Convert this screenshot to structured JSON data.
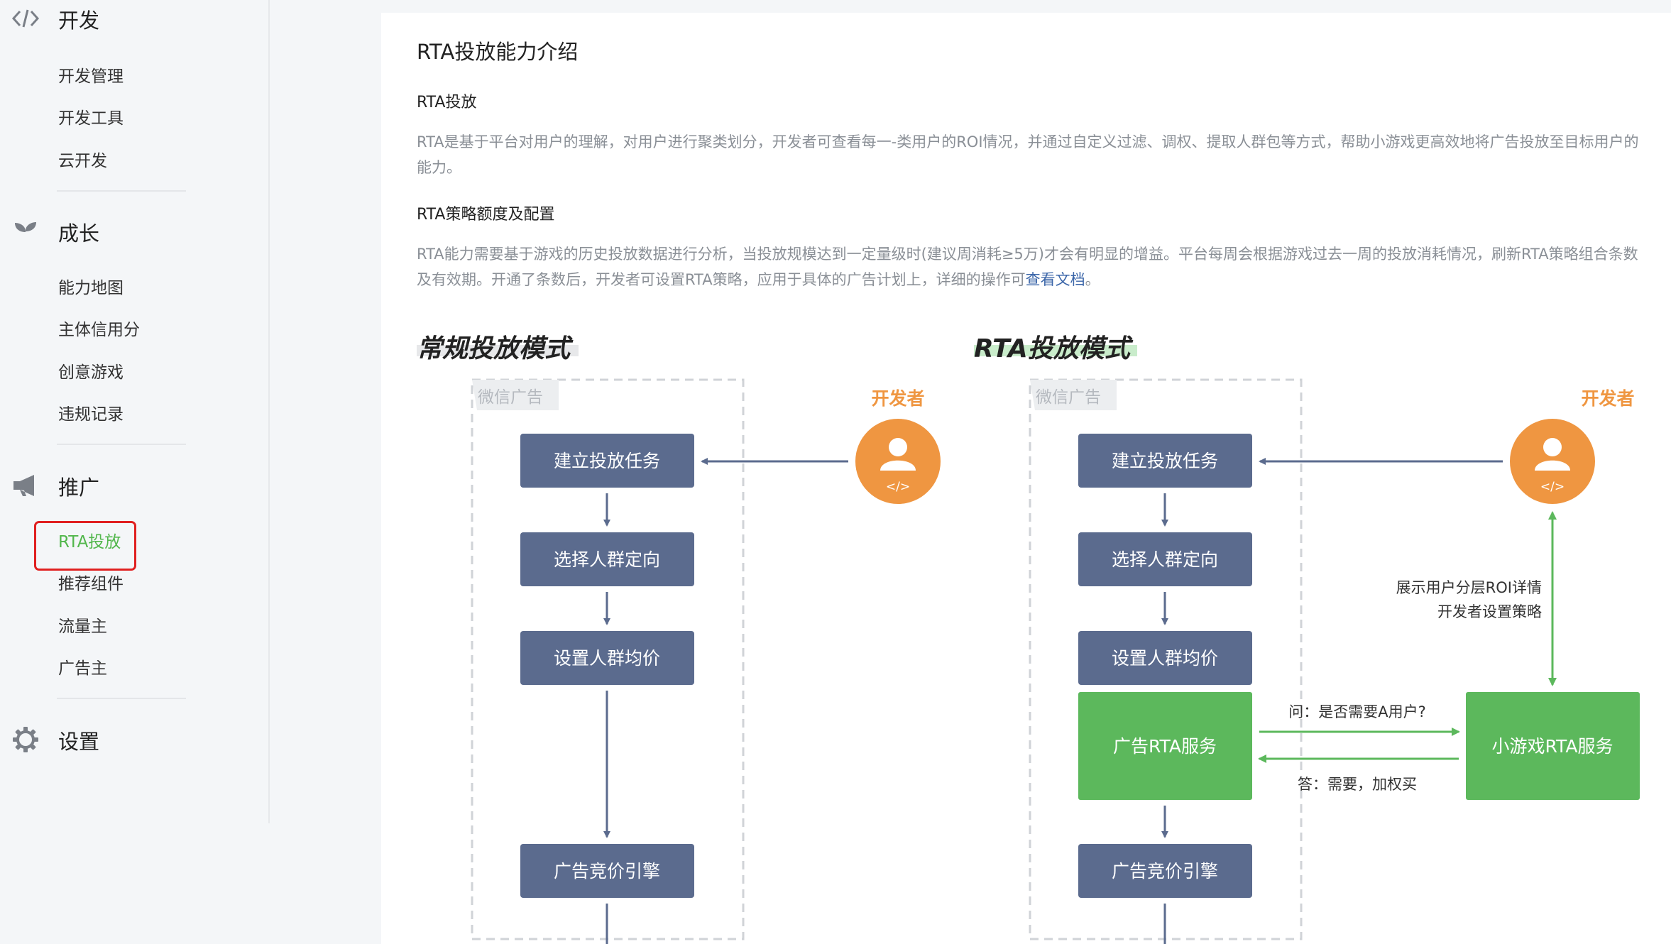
{
  "sidebar": {
    "sections": [
      {
        "title": "开发",
        "icon": "code-icon",
        "items": [
          "开发管理",
          "开发工具",
          "云开发"
        ]
      },
      {
        "title": "成长",
        "icon": "sprout-icon",
        "items": [
          "能力地图",
          "主体信用分",
          "创意游戏",
          "违规记录"
        ]
      },
      {
        "title": "推广",
        "icon": "megaphone-icon",
        "items": [
          "RTA投放",
          "推荐组件",
          "流量主",
          "广告主"
        ]
      },
      {
        "title": "设置",
        "icon": "gear-icon",
        "items": []
      }
    ],
    "active_item": "RTA投放"
  },
  "content": {
    "title": "RTA投放能力介绍",
    "s1_title": "RTA投放",
    "s1_text": "RTA是基于平台对用户的理解，对用户进行聚类划分，开发者可查看每一-类用户的ROI情况，并通过自定义过滤、调权、提取人群包等方式，帮助小游戏更高效地将广告投放至目标用户的能力。",
    "s2_title": "RTA策略额度及配置",
    "s2_text": "RTA能力需要基于游戏的历史投放数据进行分析，当投放规模达到一定量级时(建议周消耗≥5万)才会有明显的增益。平台每周会根据游戏过去一周的投放消耗情况，刷新RTA策略组合条数及有效期。开通了条数后，开发者可设置RTA策略，应用于具体的广告计划上，详细的操作可",
    "s2_link": "查看文档",
    "s2_end": "。"
  },
  "diagram": {
    "left_title": "常规投放模式",
    "right_title": "RTA投放模式",
    "container_label": "微信广告",
    "developer_label": "开发者",
    "steps": [
      "建立投放任务",
      "选择人群定向",
      "设置人群均价",
      "广告竞价引擎"
    ],
    "rta_service": "广告RTA服务",
    "game_rta_service": "小游戏RTA服务",
    "question": "问：是否需要A用户?",
    "answer": "答：需要，加权买",
    "roi_line1": "展示用户分层ROI详情",
    "roi_line2": "开发者设置策略",
    "colors": {
      "box": "#5b6b8e",
      "green": "#5cb85c",
      "orange": "#ef9641",
      "highlight_gray": "#e7e8ea",
      "highlight_green": "#c9eccb"
    }
  }
}
